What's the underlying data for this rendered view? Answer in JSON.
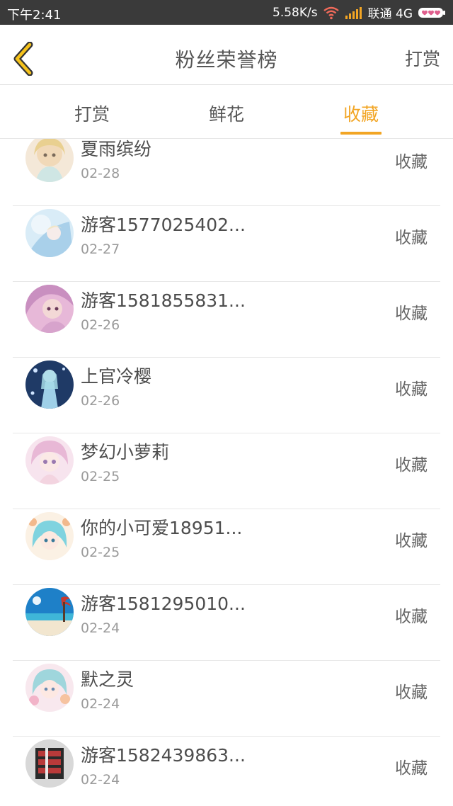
{
  "status_bar": {
    "time": "下午2:41",
    "speed": "5.58K/s",
    "carrier": "联通 4G"
  },
  "header": {
    "title": "粉丝荣誉榜",
    "action": "打赏"
  },
  "tabs": [
    {
      "label": "打赏",
      "active": false
    },
    {
      "label": "鲜花",
      "active": false
    },
    {
      "label": "收藏",
      "active": true
    }
  ],
  "colors": {
    "accent": "#f2a524",
    "status_bar": "#3a3a3a"
  },
  "list": [
    {
      "name": "夏雨缤纷",
      "date": "02-28",
      "action": "收藏"
    },
    {
      "name": "游客1577025402...",
      "date": "02-27",
      "action": "收藏"
    },
    {
      "name": "游客1581855831...",
      "date": "02-26",
      "action": "收藏"
    },
    {
      "name": "上官冷樱",
      "date": "02-26",
      "action": "收藏"
    },
    {
      "name": "梦幻小萝莉",
      "date": "02-25",
      "action": "收藏"
    },
    {
      "name": "你的小可爱18951...",
      "date": "02-25",
      "action": "收藏"
    },
    {
      "name": "游客1581295010...",
      "date": "02-24",
      "action": "收藏"
    },
    {
      "name": "默之灵",
      "date": "02-24",
      "action": "收藏"
    },
    {
      "name": "游客1582439863...",
      "date": "02-24",
      "action": "收藏"
    }
  ]
}
